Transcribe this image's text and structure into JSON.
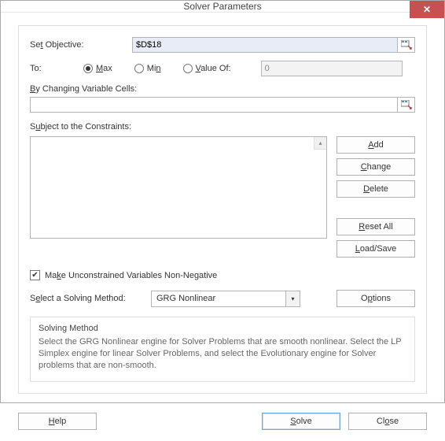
{
  "titlebar": {
    "title": "Solver Parameters",
    "close_glyph": "✕"
  },
  "labels": {
    "set_objective_pre": "Se",
    "set_objective_u": "t",
    "set_objective_post": " Objective:",
    "to": "To:",
    "by_changing_u": "B",
    "by_changing_post": "y Changing Variable Cells:",
    "subject_pre": "S",
    "subject_u": "u",
    "subject_post": "bject to the Constraints:",
    "unconstrained_pre": "Ma",
    "unconstrained_u": "k",
    "unconstrained_post": "e Unconstrained Variables Non-Negative",
    "select_method_pre": "S",
    "select_method_u": "e",
    "select_method_post": "lect a Solving Method:"
  },
  "objective": {
    "value": "$D$18"
  },
  "radios": {
    "max_u": "M",
    "max_post": "ax",
    "min_pre": "Mi",
    "min_u": "n",
    "value_u": "V",
    "value_post": "alue Of:",
    "selected": "max",
    "value_input": "0"
  },
  "changing_cells": {
    "value": ""
  },
  "buttons": {
    "add_u": "A",
    "add_post": "dd",
    "change_u": "C",
    "change_post": "hange",
    "delete_u": "D",
    "delete_post": "elete",
    "reset_u": "R",
    "reset_post": "eset All",
    "loadsave_u": "L",
    "loadsave_post": "oad/Save",
    "options_pre": "O",
    "options_u": "p",
    "options_post": "tions",
    "help_u": "H",
    "help_post": "elp",
    "solve_u": "S",
    "solve_post": "olve",
    "close_pre": "Cl",
    "close_u": "o",
    "close_post": "se"
  },
  "unconstrained_checked": true,
  "solving_method": {
    "selected": "GRG Nonlinear"
  },
  "method_box": {
    "heading": "Solving Method",
    "text": "Select the GRG Nonlinear engine for Solver Problems that are smooth nonlinear. Select the LP Simplex engine for linear Solver Problems, and select the Evolutionary engine for Solver problems that are non-smooth."
  }
}
